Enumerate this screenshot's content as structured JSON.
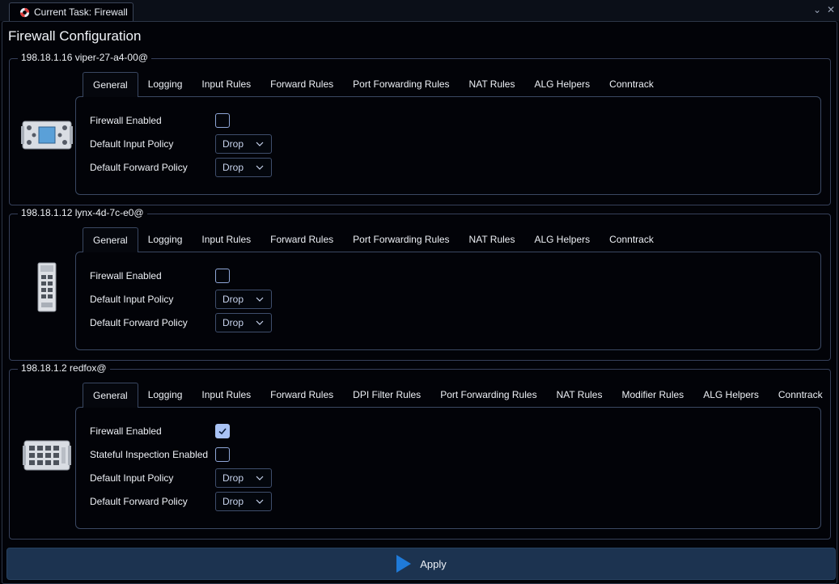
{
  "window": {
    "tab_title": "Current Task: Firewall",
    "page_title": "Firewall Configuration"
  },
  "devices": [
    {
      "legend": "198.18.1.16 viper-27-a4-00@",
      "tabs": [
        "General",
        "Logging",
        "Input Rules",
        "Forward Rules",
        "Port Forwarding Rules",
        "NAT Rules",
        "ALG Helpers",
        "Conntrack"
      ],
      "firewall_enabled_label": "Firewall Enabled",
      "firewall_enabled": false,
      "input_policy_label": "Default Input Policy",
      "input_policy": "Drop",
      "forward_policy_label": "Default Forward Policy",
      "forward_policy": "Drop"
    },
    {
      "legend": "198.18.1.12 lynx-4d-7c-e0@",
      "tabs": [
        "General",
        "Logging",
        "Input Rules",
        "Forward Rules",
        "Port Forwarding Rules",
        "NAT Rules",
        "ALG Helpers",
        "Conntrack"
      ],
      "firewall_enabled_label": "Firewall Enabled",
      "firewall_enabled": false,
      "input_policy_label": "Default Input Policy",
      "input_policy": "Drop",
      "forward_policy_label": "Default Forward Policy",
      "forward_policy": "Drop"
    },
    {
      "legend": "198.18.1.2 redfox@",
      "tabs": [
        "General",
        "Logging",
        "Input Rules",
        "Forward Rules",
        "DPI Filter Rules",
        "Port Forwarding Rules",
        "NAT Rules",
        "Modifier Rules",
        "ALG Helpers",
        "Conntrack"
      ],
      "firewall_enabled_label": "Firewall Enabled",
      "firewall_enabled": true,
      "stateful_label": "Stateful Inspection Enabled",
      "stateful_enabled": false,
      "input_policy_label": "Default Input Policy",
      "input_policy": "Drop",
      "forward_policy_label": "Default Forward Policy",
      "forward_policy": "Drop"
    }
  ],
  "apply_label": "Apply",
  "colors": {
    "accent": "#1f7ad8",
    "checkbox_checked": "#a9c3f5",
    "apply_bar": "#1c3350"
  }
}
